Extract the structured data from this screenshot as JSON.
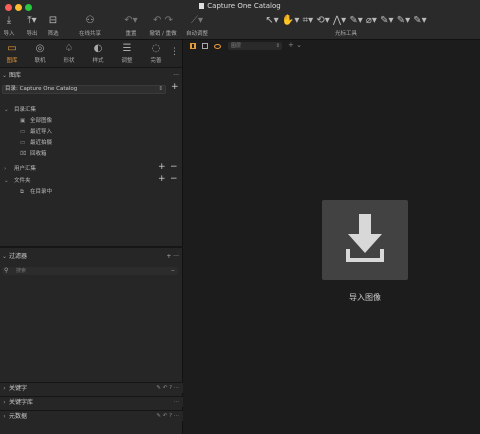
{
  "window": {
    "title": "Capture One Catalog"
  },
  "toolbar": {
    "import": "导入",
    "export": "导出",
    "filter": "筛选",
    "live_share": "在线共享",
    "reset": "重置",
    "undo_redo": "撤销 / 重做",
    "auto_adjust": "自动调整",
    "cursor_tools": "光标工具"
  },
  "tabs": [
    {
      "label": "图库",
      "icon": "library-icon",
      "active": true
    },
    {
      "label": "联机",
      "icon": "camera-icon"
    },
    {
      "label": "形状",
      "icon": "lens-icon"
    },
    {
      "label": "样式",
      "icon": "styles-icon"
    },
    {
      "label": "调整",
      "icon": "sliders-icon"
    },
    {
      "label": "完善",
      "icon": "refine-icon"
    }
  ],
  "library": {
    "title": "图库",
    "catalog_label": "目录: Capture One Catalog",
    "catalog_collection": "目录汇集",
    "all_images": "全部图像",
    "recent_imports": "最近导入",
    "recent_captures": "最近拍摄",
    "trash": "回收箱",
    "user_collections": "用户汇集",
    "folders": "文件夹",
    "in_catalog": "在目录中"
  },
  "filters": {
    "title": "过滤器",
    "search_placeholder": "搜索"
  },
  "bottom_sections": {
    "keywords": "关键字",
    "keyword_library": "关键字库",
    "metadata": "元数据"
  },
  "viewer": {
    "sort_value": "图层",
    "import_label": "导入图像"
  },
  "colors": {
    "accent": "#e79a3a",
    "panel": "#262626",
    "viewer_bg": "#1c1c1c",
    "import_box": "#424242"
  }
}
